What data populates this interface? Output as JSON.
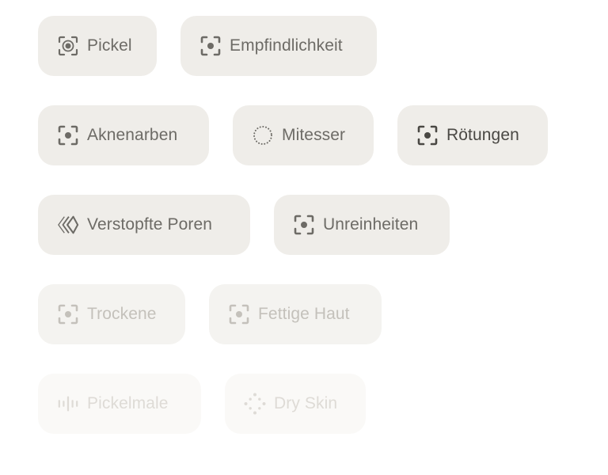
{
  "chips": [
    {
      "label": "Pickel",
      "icon": "focus-target-icon"
    },
    {
      "label": "Empfindlichkeit",
      "icon": "focus-frame-icon"
    },
    {
      "label": "Aknenarben",
      "icon": "focus-frame-icon"
    },
    {
      "label": "Mitesser",
      "icon": "dotted-circle-icon"
    },
    {
      "label": "Rötungen",
      "icon": "focus-frame-icon"
    },
    {
      "label": "Verstopfte Poren",
      "icon": "chevrons-icon"
    },
    {
      "label": "Unreinheiten",
      "icon": "focus-frame-icon"
    },
    {
      "label": "Trockene",
      "icon": "focus-frame-icon"
    },
    {
      "label": "Fettige Haut",
      "icon": "focus-frame-icon"
    },
    {
      "label": "Pickelmale",
      "icon": "bars-icon"
    },
    {
      "label": "Dry Skin",
      "icon": "diamond-dots-icon"
    }
  ]
}
